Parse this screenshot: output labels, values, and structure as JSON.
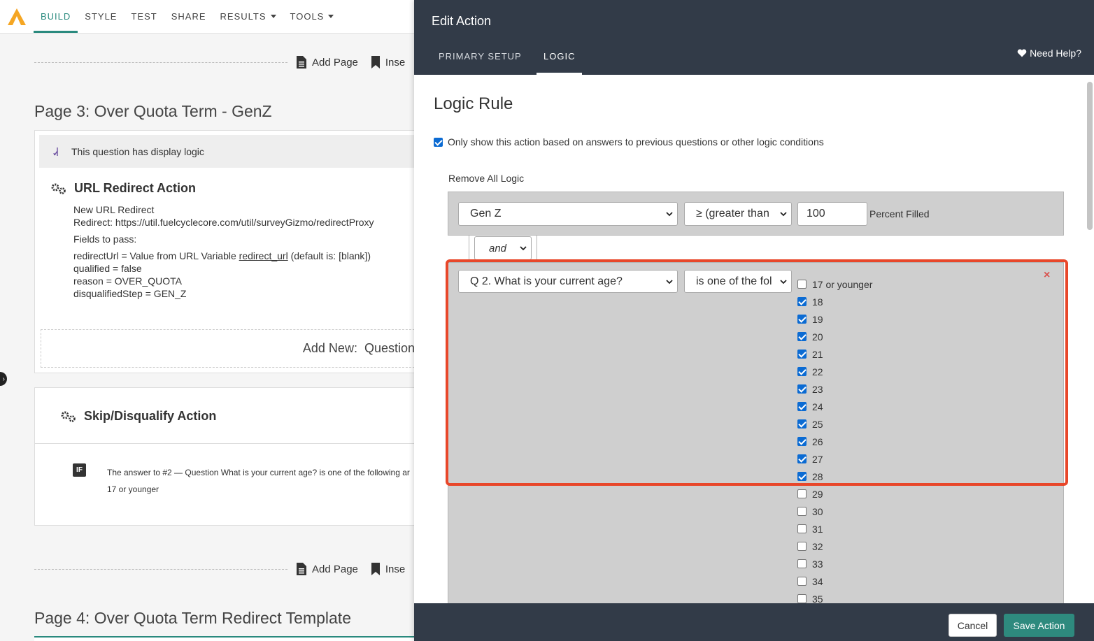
{
  "nav": {
    "items": [
      "BUILD",
      "STYLE",
      "TEST",
      "SHARE",
      "RESULTS",
      "TOOLS"
    ],
    "active": "BUILD",
    "accent": "#2a8a7e"
  },
  "builder": {
    "add_page_label": "Add Page",
    "insert_label": "Inse",
    "page3_title": "Page 3: Over Quota Term - GenZ",
    "display_logic_note": "This question has display logic",
    "url_action": {
      "title": "URL Redirect Action",
      "name": "New URL Redirect",
      "redirect": "Redirect: https://util.fuelcyclecore.com/util/surveyGizmo/redirectProxy",
      "fields_label": "Fields to pass:",
      "field1_prefix": "redirectUrl = Value from URL Variable ",
      "field1_var": "redirect_url",
      "field1_suffix": " (default is: [blank])",
      "field2": "qualified = false",
      "field3": "reason = OVER_QUOTA",
      "field4": "disqualifiedStep = GEN_Z"
    },
    "add_new_label": "Add New:",
    "add_new_type": "Question",
    "skip_action": {
      "title": "Skip/Disqualify Action",
      "if_badge": "IF",
      "condition_line1": "The answer to #2 — Question What is your current age? is one of the following ar",
      "condition_line2": "17 or younger"
    },
    "page4_title": "Page 4: Over Quota Term Redirect Template"
  },
  "panel": {
    "title": "Edit Action",
    "tabs": [
      "PRIMARY SETUP",
      "LOGIC"
    ],
    "active_tab": "LOGIC",
    "help_label": "Need Help?",
    "rule_title": "Logic Rule",
    "only_show_label": "Only show this action based on answers to previous questions or other logic conditions",
    "only_show_checked": true,
    "remove_all_label": "Remove All Logic",
    "condition1": {
      "field": "Gen Z",
      "operator": "≥ (greater than",
      "value": "100",
      "suffix": "Percent Filled"
    },
    "connector": "and",
    "condition2": {
      "field": "Q 2. What is your current age?",
      "operator": "is one of the fol",
      "options": [
        {
          "label": "17 or younger",
          "checked": false
        },
        {
          "label": "18",
          "checked": true
        },
        {
          "label": "19",
          "checked": true
        },
        {
          "label": "20",
          "checked": true
        },
        {
          "label": "21",
          "checked": true
        },
        {
          "label": "22",
          "checked": true
        },
        {
          "label": "23",
          "checked": true
        },
        {
          "label": "24",
          "checked": true
        },
        {
          "label": "25",
          "checked": true
        },
        {
          "label": "26",
          "checked": true
        },
        {
          "label": "27",
          "checked": true
        },
        {
          "label": "28",
          "checked": true
        },
        {
          "label": "29",
          "checked": false
        },
        {
          "label": "30",
          "checked": false
        },
        {
          "label": "31",
          "checked": false
        },
        {
          "label": "32",
          "checked": false
        },
        {
          "label": "33",
          "checked": false
        },
        {
          "label": "34",
          "checked": false
        },
        {
          "label": "35",
          "checked": false
        }
      ],
      "remove_icon": "×"
    },
    "cancel_label": "Cancel",
    "save_label": "Save Action",
    "highlight_color": "#e8472a"
  }
}
